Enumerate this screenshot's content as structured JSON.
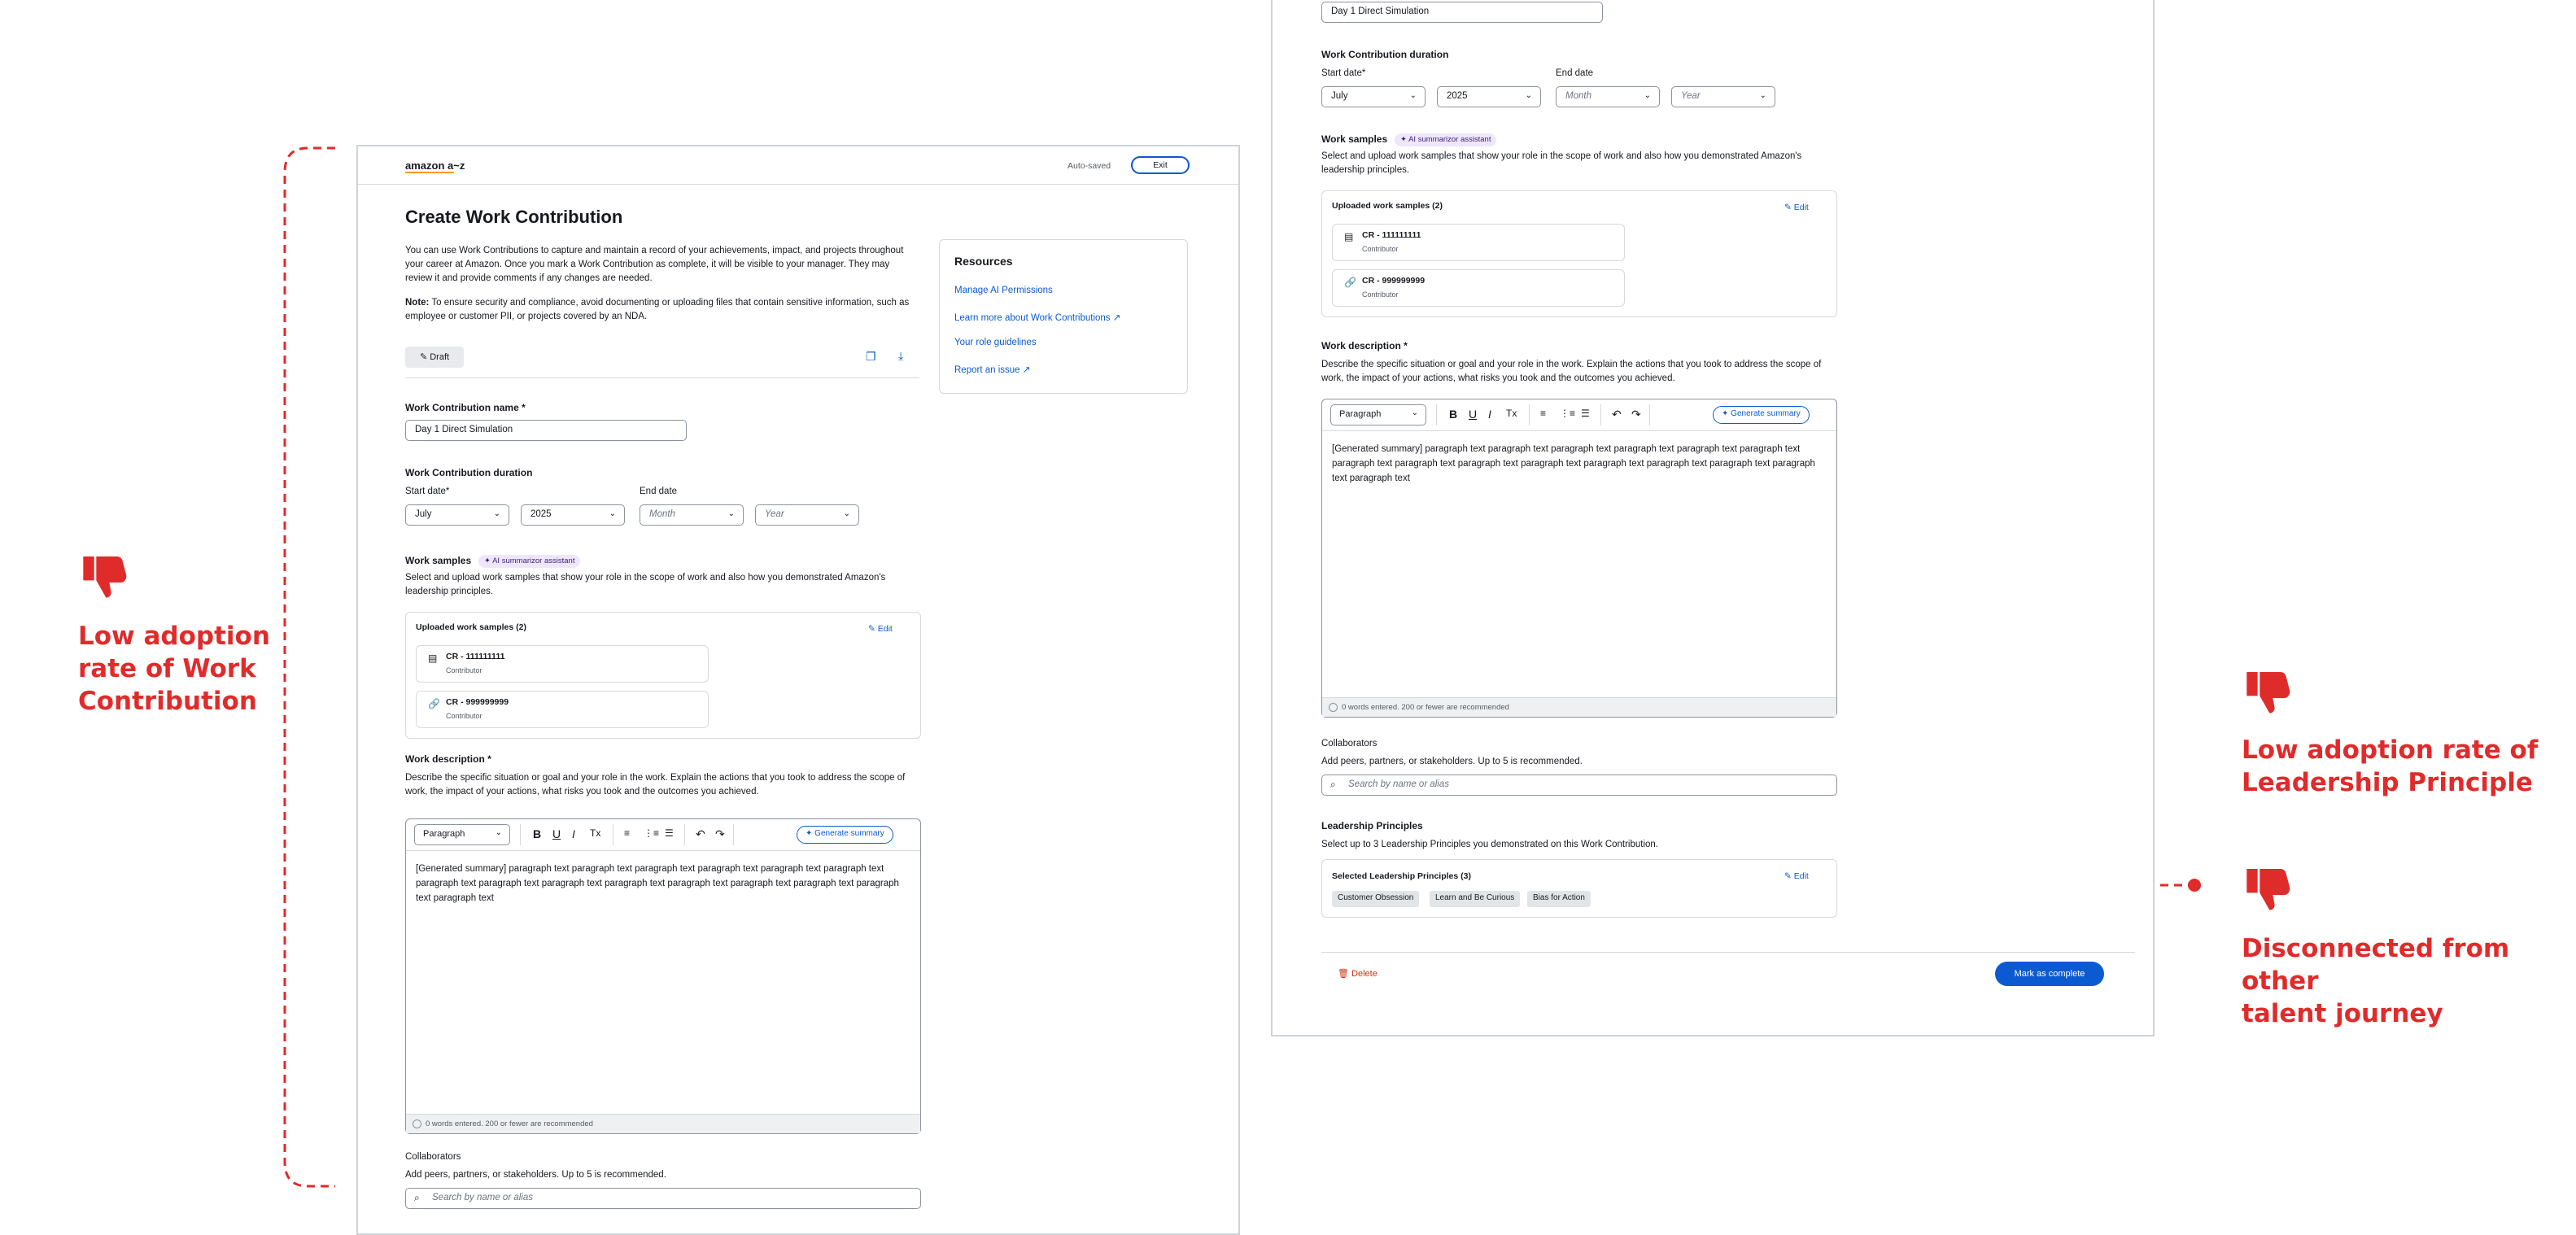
{
  "colors": {
    "accent": "#0b5ad1",
    "annotation_red": "#e02b2b",
    "ai_pill_bg": "#efe6fb",
    "delete_red": "#d13212"
  },
  "left_panel": {
    "logo": "amazon a~z",
    "autosaved": "Auto-saved",
    "exit_label": "Exit",
    "page_title": "Create Work Contribution",
    "intro": "You can use Work Contributions to capture and maintain a record of your achievements, impact, and projects throughout your career at Amazon. Once you mark a Work Contribution as complete, it will be visible to your manager. They may review it and provide comments if any changes are needed.",
    "note_label": "Note:",
    "note_text": " To ensure security and compliance, avoid documenting or uploading files that contain sensitive information, such as employee or customer PII, or projects covered by an NDA.",
    "draft_label": "Draft",
    "resources": {
      "title": "Resources",
      "links": [
        "Manage AI Permissions",
        "Learn more about Work Contributions",
        "Your role guidelines",
        "Report an issue"
      ]
    },
    "name_label": "Work Contribution name *",
    "name_value": "Day 1 Direct Simulation",
    "duration_label": "Work Contribution duration",
    "start_label": "Start date*",
    "end_label": "End date",
    "start_month": "July",
    "start_year": "2025",
    "end_month_placeholder": "Month",
    "end_year_placeholder": "Year",
    "samples_label": "Work samples",
    "ai_pill": "AI summarizor assistant",
    "samples_desc": "Select and upload work samples that show your role in the scope of work and also how you demonstrated Amazon's leadership principles.",
    "uploaded_title": "Uploaded work samples (2)",
    "edit_label": "Edit",
    "samples": [
      {
        "title": "CR - 111111111",
        "role": "Contributor"
      },
      {
        "title": "CR - 999999999",
        "role": "Contributor"
      }
    ],
    "desc_label": "Work description *",
    "desc_help": "Describe the specific situation or goal and your role in the work. Explain the actions that you took to address the scope of work, the impact of your actions, what risks you took and the outcomes you achieved.",
    "paragraph_select": "Paragraph",
    "generate_summary": "Generate summary",
    "editor_text": "[Generated summary] paragraph text paragraph text paragraph text paragraph text paragraph text paragraph text paragraph text paragraph text paragraph text paragraph text paragraph text paragraph text paragraph text paragraph text paragraph text",
    "words_footer": "0 words entered. 200 or fewer are recommended",
    "collab_label": "Collaborators",
    "collab_help": "Add peers, partners, or stakeholders. Up to 5 is recommended.",
    "collab_placeholder": "Search by name or alias"
  },
  "right_panel": {
    "name_value": "Day 1 Direct Simulation",
    "duration_label": "Work Contribution duration",
    "start_label": "Start date*",
    "end_label": "End date",
    "start_month": "July",
    "start_year": "2025",
    "end_month_placeholder": "Month",
    "end_year_placeholder": "Year",
    "samples_label": "Work samples",
    "ai_pill": "AI summarizor assistant",
    "samples_desc": "Select and upload work samples that show your role in the scope of work and also how you demonstrated Amazon's leadership principles.",
    "uploaded_title": "Uploaded work samples (2)",
    "edit_label": "Edit",
    "samples": [
      {
        "title": "CR - 111111111",
        "role": "Contributor"
      },
      {
        "title": "CR - 999999999",
        "role": "Contributor"
      }
    ],
    "desc_label": "Work description *",
    "desc_help": "Describe the specific situation or goal and your role in the work. Explain the actions that you took to address the scope of work, the impact of your actions, what risks you took and the outcomes you achieved.",
    "paragraph_select": "Paragraph",
    "generate_summary": "Generate summary",
    "editor_text": "[Generated summary] paragraph text paragraph text paragraph text paragraph text paragraph text paragraph text paragraph text paragraph text paragraph text paragraph text paragraph text paragraph text paragraph text paragraph text paragraph text",
    "words_footer": "0 words entered. 200 or fewer are recommended",
    "collab_label": "Collaborators",
    "collab_help": "Add peers, partners, or stakeholders. Up to 5 is recommended.",
    "collab_placeholder": "Search by name or alias",
    "lp_label": "Leadership Principles",
    "lp_help": "Select up to 3 Leadership Principles you demonstrated on this Work Contribution.",
    "lp_selected_title": "Selected Leadership Principles (3)",
    "lp_tags": [
      "Customer Obsession",
      "Learn and Be Curious",
      "Bias for Action"
    ],
    "delete_label": "Delete",
    "complete_label": "Mark as complete"
  },
  "annotations": {
    "left": [
      "Low adoption",
      "rate of Work",
      "Contribution"
    ],
    "right_top": [
      "Low adoption rate of",
      "Leadership Principle"
    ],
    "right_bottom": [
      "Disconnected from",
      "other",
      "talent journey"
    ]
  }
}
